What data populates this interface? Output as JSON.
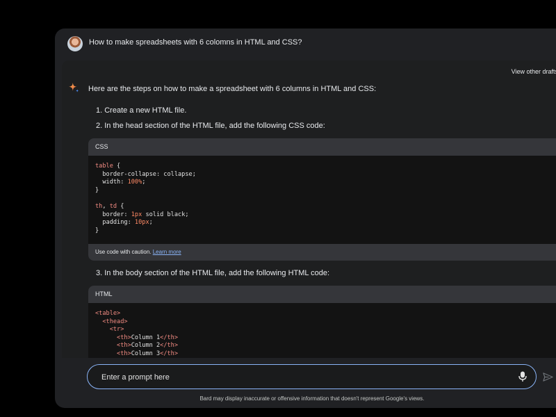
{
  "conversation": {
    "user_prompt": "How to make spreadsheets with 6 colomns in HTML and CSS?"
  },
  "response": {
    "view_drafts_label": "View other drafts",
    "intro": "Here are the steps on how to make a spreadsheet with 6 columns in HTML and CSS:",
    "steps": [
      "1. Create a new HTML file.",
      "2. In the head section of the HTML file, add the following CSS code:",
      "3. In the body section of the HTML file, add the following HTML code:"
    ],
    "css_block": {
      "language": "CSS",
      "caution_text": "Use code with caution.",
      "learn_more": "Learn more"
    },
    "html_block": {
      "language": "HTML"
    }
  },
  "input": {
    "placeholder": "Enter a prompt here"
  },
  "footer": {
    "disclaimer": "Bard may display inaccurate or offensive information that doesn't represent Google's views."
  },
  "colors": {
    "accent": "#8ab4f8",
    "code_keyword": "#f28b82",
    "code_number": "#ff8a65"
  }
}
